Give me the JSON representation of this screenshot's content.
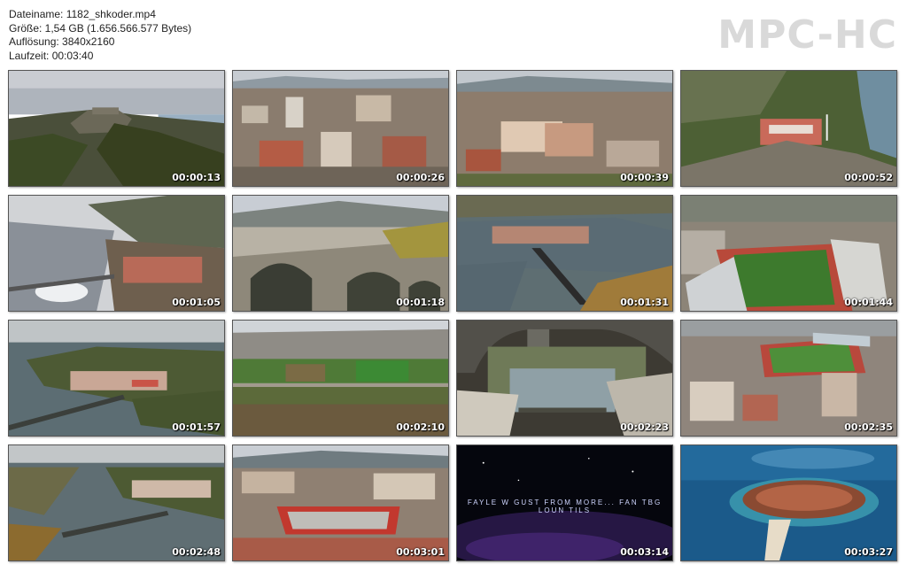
{
  "file_info": {
    "filename": "Dateiname: 1182_shkoder.mp4",
    "size": "Größe: 1,54 GB (1.656.566.577 Bytes)",
    "resolution": "Auflösung: 3840x2160",
    "duration": "Laufzeit: 00:03:40"
  },
  "brand": "MPC-HC",
  "thumbnails": [
    {
      "timestamp": "00:00:13"
    },
    {
      "timestamp": "00:00:26"
    },
    {
      "timestamp": "00:00:39"
    },
    {
      "timestamp": "00:00:52"
    },
    {
      "timestamp": "00:01:05"
    },
    {
      "timestamp": "00:01:18"
    },
    {
      "timestamp": "00:01:31"
    },
    {
      "timestamp": "00:01:44"
    },
    {
      "timestamp": "00:01:57"
    },
    {
      "timestamp": "00:02:10"
    },
    {
      "timestamp": "00:02:23"
    },
    {
      "timestamp": "00:02:35"
    },
    {
      "timestamp": "00:02:48"
    },
    {
      "timestamp": "00:03:01"
    },
    {
      "timestamp": "00:03:14",
      "caption": "FAYLE W GUST FROM MORE... FAN TBG LOUN TILS"
    },
    {
      "timestamp": "00:03:27"
    }
  ]
}
